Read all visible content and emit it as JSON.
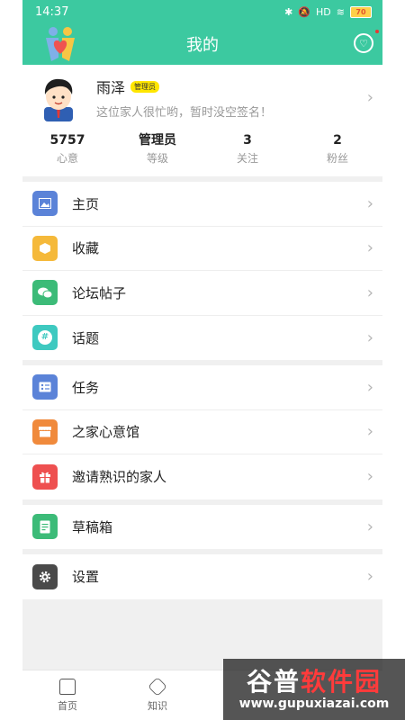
{
  "status_bar": {
    "time": "14:37",
    "battery": "70",
    "network": "HD"
  },
  "header": {
    "title": "我的"
  },
  "profile": {
    "name": "雨泽",
    "badge": "管理员",
    "signature": "这位家人很忙哟，暂时没空签名！"
  },
  "stats": [
    {
      "value": "5757",
      "label": "心意"
    },
    {
      "value": "管理员",
      "label": "等级"
    },
    {
      "value": "3",
      "label": "关注"
    },
    {
      "value": "2",
      "label": "粉丝"
    }
  ],
  "menu_groups": [
    [
      {
        "label": "主页",
        "icon": "image-icon",
        "color": "#5b83d8"
      },
      {
        "label": "收藏",
        "icon": "box-icon",
        "color": "#f5b93a"
      },
      {
        "label": "论坛帖子",
        "icon": "chat-icon",
        "color": "#3cbb78"
      },
      {
        "label": "话题",
        "icon": "hashtag-icon",
        "color": "#3ec9c0"
      }
    ],
    [
      {
        "label": "任务",
        "icon": "task-icon",
        "color": "#5b83d8"
      },
      {
        "label": "之家心意馆",
        "icon": "store-icon",
        "color": "#f08a3c"
      },
      {
        "label": "邀请熟识的家人",
        "icon": "gift-icon",
        "color": "#ee5050"
      }
    ],
    [
      {
        "label": "草稿箱",
        "icon": "draft-icon",
        "color": "#3cbb78"
      }
    ],
    [
      {
        "label": "设置",
        "icon": "gear-icon",
        "color": "#4a4a4a"
      }
    ]
  ],
  "bottom_nav": [
    {
      "label": "首页",
      "icon": "home-icon"
    },
    {
      "label": "知识",
      "icon": "knowledge-icon"
    }
  ],
  "watermark": {
    "text_a": "谷普",
    "text_b": "软件园",
    "url": "www.gupuxiazai.com"
  }
}
